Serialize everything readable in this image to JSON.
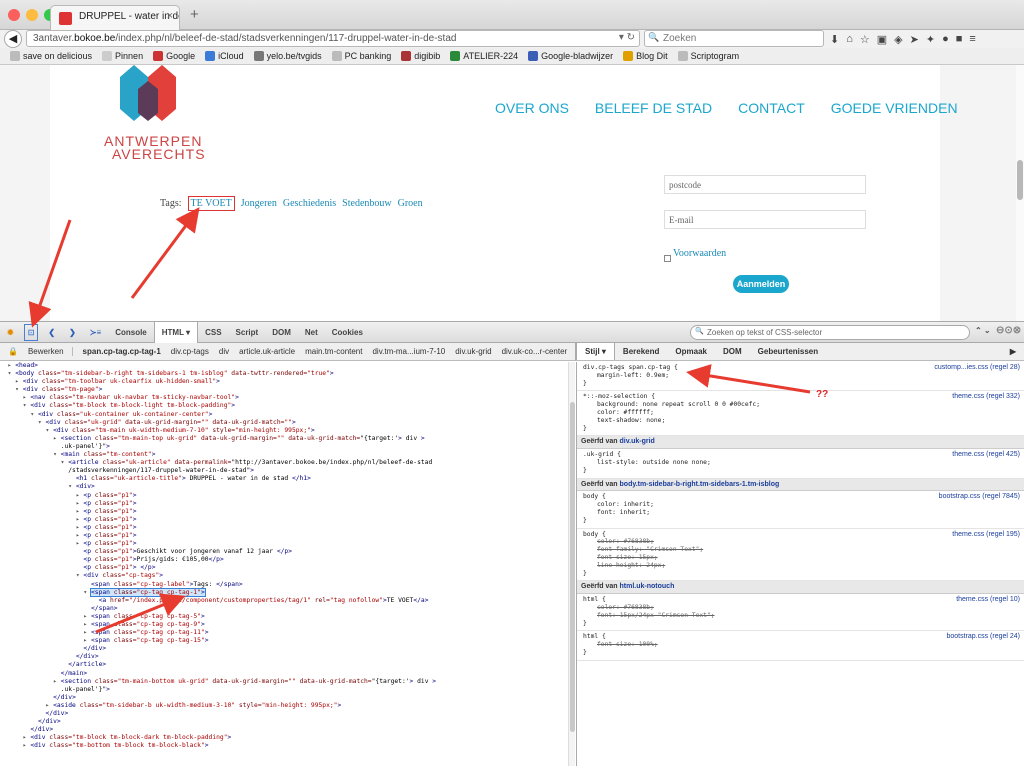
{
  "browser": {
    "tab_title": "DRUPPEL - water in de stad",
    "url_plain_prefix": "3antaver.",
    "url_domain": "bokoe.be",
    "url_path": "/index.php/nl/beleef-de-stad/stadsverkenningen/117-druppel-water-in-de-stad",
    "search_placeholder": "Zoeken",
    "bookmarks": [
      "save on delicious",
      "Pinnen",
      "Google",
      "iCloud",
      "yelo.be/tvgids",
      "PC banking",
      "digibib",
      "ATELIER-224",
      "Google-bladwijzer",
      "Blog Dit",
      "Scriptogram"
    ]
  },
  "site": {
    "logo_line1": "ANTWERPEN",
    "logo_line2": "AVERECHTS",
    "menu": [
      "OVER ONS",
      "BELEEF DE STAD",
      "CONTACT",
      "GOEDE VRIENDEN"
    ],
    "tags_label": "Tags:",
    "tags": [
      "TE VOET",
      "Jongeren",
      "Geschiedenis",
      "Stedenbouw",
      "Groen"
    ],
    "postcode_placeholder": "postcode",
    "email_placeholder": "E-mail",
    "terms_label": "Voorwaarden",
    "submit_label": "Aanmelden"
  },
  "firebug": {
    "tabs": [
      "Console",
      "HTML",
      "CSS",
      "Script",
      "DOM",
      "Net",
      "Cookies"
    ],
    "active_tab": "HTML",
    "search_placeholder": "Zoeken op tekst of CSS-selector",
    "edit_label": "Bewerken",
    "breadcrumbs": [
      "span.cp-tag.cp-tag-1",
      "div.cp-tags",
      "div",
      "article.uk-article",
      "main.tm-content",
      "div.tm-ma...ium-7-10",
      "div.uk-grid",
      "div.uk-co...r-center"
    ],
    "side_tabs": [
      "Stijl",
      "Berekend",
      "Opmaak",
      "DOM",
      "Gebeurtenissen"
    ],
    "active_side_tab": "Stijl"
  },
  "html_tree": [
    {
      "i": 0,
      "t": "▸",
      "c": "<head>"
    },
    {
      "i": 0,
      "t": "▾",
      "c": "<body class=\"tm-sidebar-b-right tm-sidebars-1 tm-isblog\" data-twttr-rendered=\"true\">"
    },
    {
      "i": 1,
      "t": "▸",
      "c": "<div class=\"tm-toolbar uk-clearfix uk-hidden-small\">"
    },
    {
      "i": 1,
      "t": "▾",
      "c": "<div class=\"tm-page\">"
    },
    {
      "i": 2,
      "t": "▸",
      "c": "<nav class=\"tm-navbar uk-navbar tm-sticky-navbar-tool\">"
    },
    {
      "i": 2,
      "t": "▾",
      "c": "<div class=\"tm-block tm-block-light tm-block-padding\">"
    },
    {
      "i": 3,
      "t": "▾",
      "c": "<div class=\"uk-container uk-container-center\">"
    },
    {
      "i": 4,
      "t": "▾",
      "c": "<div class=\"uk-grid\" data-uk-grid-margin=\"\" data-uk-grid-match=\"\">"
    },
    {
      "i": 5,
      "t": "▾",
      "c": "<div class=\"tm-main uk-width-medium-7-10\" style=\"min-height: 995px;\">"
    },
    {
      "i": 6,
      "t": "▸",
      "c": "<section class=\"tm-main-top uk-grid\" data-uk-grid-margin=\"\" data-uk-grid-match=\"{target:'> div >"
    },
    {
      "i": 6,
      "t": " ",
      "c": ".uk-panel'}\">"
    },
    {
      "i": 6,
      "t": "▾",
      "c": "<main class=\"tm-content\">"
    },
    {
      "i": 7,
      "t": "▾",
      "c": "<article class=\"uk-article\" data-permalink=\"http://3antaver.bokoe.be/index.php/nl/beleef-de-stad"
    },
    {
      "i": 7,
      "t": " ",
      "c": "/stadsverkenningen/117-druppel-water-in-de-stad\">"
    },
    {
      "i": 8,
      "t": " ",
      "c": "<h1 class=\"uk-article-title\"> DRUPPEL - water in de stad </h1>"
    },
    {
      "i": 8,
      "t": "▾",
      "c": "<div>"
    },
    {
      "i": 9,
      "t": "▸",
      "c": "<p class=\"p1\">"
    },
    {
      "i": 9,
      "t": "▸",
      "c": "<p class=\"p1\">"
    },
    {
      "i": 9,
      "t": "▸",
      "c": "<p class=\"p1\">"
    },
    {
      "i": 9,
      "t": "▸",
      "c": "<p class=\"p1\">"
    },
    {
      "i": 9,
      "t": "▸",
      "c": "<p class=\"p1\">"
    },
    {
      "i": 9,
      "t": "▸",
      "c": "<p class=\"p1\">"
    },
    {
      "i": 9,
      "t": "▸",
      "c": "<p class=\"p1\">"
    },
    {
      "i": 9,
      "t": " ",
      "c": "<p class=\"p1\">Geschikt voor jongeren vanaf 12 jaar </p>"
    },
    {
      "i": 9,
      "t": " ",
      "c": "<p class=\"p1\">Prijs/gids: €105,00</p>"
    },
    {
      "i": 9,
      "t": " ",
      "c": "<p class=\"p1\"> </p>"
    },
    {
      "i": 9,
      "t": "▾",
      "c": "<div class=\"cp-tags\">"
    },
    {
      "i": 10,
      "t": " ",
      "c": "<span class=\"cp-tag-label\">Tags: </span>"
    },
    {
      "i": 10,
      "t": "▾",
      "c": "<span class=\"cp-tag cp-tag-1\">",
      "sel": true
    },
    {
      "i": 11,
      "t": " ",
      "c": "<a href=\"/index.php/nl/component/customproperties/tag/1\" rel=\"tag nofollow\">TE VOET</a>"
    },
    {
      "i": 10,
      "t": " ",
      "c": "</span>"
    },
    {
      "i": 10,
      "t": "▸",
      "c": "<span class=\"cp-tag cp-tag-5\">"
    },
    {
      "i": 10,
      "t": "▸",
      "c": "<span class=\"cp-tag cp-tag-9\">"
    },
    {
      "i": 10,
      "t": "▸",
      "c": "<span class=\"cp-tag cp-tag-11\">"
    },
    {
      "i": 10,
      "t": "▸",
      "c": "<span class=\"cp-tag cp-tag-15\">"
    },
    {
      "i": 9,
      "t": " ",
      "c": "</div>"
    },
    {
      "i": 8,
      "t": " ",
      "c": "</div>"
    },
    {
      "i": 7,
      "t": " ",
      "c": "</article>"
    },
    {
      "i": 6,
      "t": " ",
      "c": "</main>"
    },
    {
      "i": 6,
      "t": "▸",
      "c": "<section class=\"tm-main-bottom uk-grid\" data-uk-grid-margin=\"\" data-uk-grid-match=\"{target:'> div >"
    },
    {
      "i": 6,
      "t": " ",
      "c": ".uk-panel'}\">"
    },
    {
      "i": 5,
      "t": " ",
      "c": "</div>"
    },
    {
      "i": 5,
      "t": "▸",
      "c": "<aside class=\"tm-sidebar-b uk-width-medium-3-10\" style=\"min-height: 995px;\">"
    },
    {
      "i": 4,
      "t": " ",
      "c": "</div>"
    },
    {
      "i": 3,
      "t": " ",
      "c": "</div>"
    },
    {
      "i": 2,
      "t": " ",
      "c": "</div>"
    },
    {
      "i": 2,
      "t": "▸",
      "c": "<div class=\"tm-block tm-block-dark tm-block-padding\">"
    },
    {
      "i": 2,
      "t": "▸",
      "c": "<div class=\"tm-bottom tm-block tm-block-black\">"
    }
  ],
  "css_panel": {
    "rule1": {
      "selector": "div.cp-tags span.cp-tag {",
      "props": [
        "margin-left: 0.9em;"
      ],
      "source": "customp...ies.css (regel 28)"
    },
    "rule2": {
      "selector": "*::-moz-selection {",
      "props": [
        "background: none repeat scroll 0 0 #00cefc;",
        "color: #ffffff;",
        "text-shadow: none;"
      ],
      "source": "theme.css (regel 332)"
    },
    "inh1_prefix": "Geërfd van",
    "inh1_target": "div.uk-grid",
    "rule3": {
      "selector": ".uk-grid {",
      "props": [
        "list-style: outside none none;"
      ],
      "source": "theme.css (regel 425)"
    },
    "inh2_prefix": "Geërfd van",
    "inh2_target": "body.tm-sidebar-b-right.tm-sidebars-1.tm-isblog",
    "rule4": {
      "selector": "body {",
      "props": [
        "color: inherit;",
        "font: inherit;"
      ],
      "source": "bootstrap.css (regel 7845)"
    },
    "rule5": {
      "selector": "body {",
      "props": [
        "color: #76838b;",
        "font-family: \"Crimson Text\";",
        "font-size: 15px;",
        "line-height: 24px;"
      ],
      "source": "theme.css (regel 195)"
    },
    "inh3_prefix": "Geërfd van",
    "inh3_target": "html.uk-notouch",
    "rule6": {
      "selector": "html {",
      "props": [
        "color: #76838b;",
        "font: 15px/24px \"Crimson Text\";"
      ],
      "source": "theme.css (regel 10)"
    },
    "rule7": {
      "selector": "html {",
      "props": [
        "font-size: 100%;"
      ],
      "source": "bootstrap.css (regel 24)"
    },
    "annotation": "??"
  }
}
